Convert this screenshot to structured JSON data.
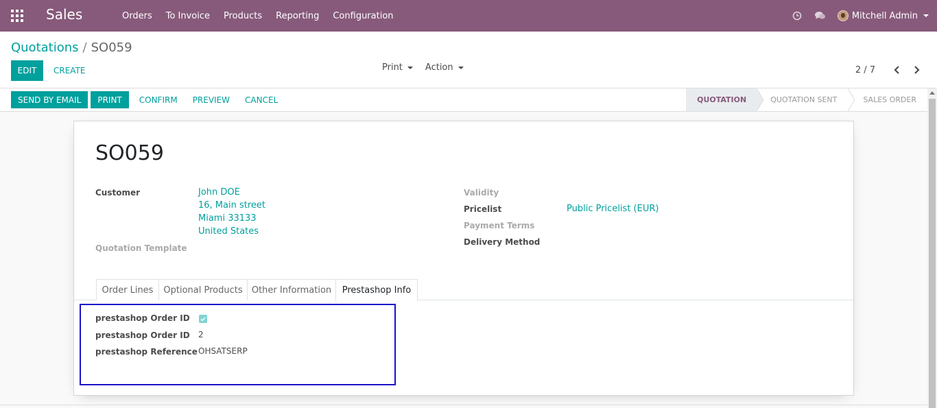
{
  "navbar": {
    "app_name": "Sales",
    "menu": [
      "Orders",
      "To Invoice",
      "Products",
      "Reporting",
      "Configuration"
    ],
    "user_name": "Mitchell Admin",
    "icons": [
      "apps-icon",
      "clock-icon",
      "chat-icon"
    ]
  },
  "control": {
    "breadcrumb_parent": "Quotations",
    "breadcrumb_current": "SO059",
    "edit_label": "EDIT",
    "create_label": "CREATE",
    "print_label": "Print",
    "action_label": "Action",
    "pager": "2 / 7"
  },
  "statusbar": {
    "buttons": [
      "SEND BY EMAIL",
      "PRINT",
      "CONFIRM",
      "PREVIEW",
      "CANCEL"
    ],
    "stages": [
      "QUOTATION",
      "QUOTATION SENT",
      "SALES ORDER"
    ],
    "active_stage": "QUOTATION"
  },
  "form": {
    "order_name": "SO059",
    "customer_label": "Customer",
    "customer_name": "John DOE",
    "customer_address": [
      "16, Main street",
      "Miami 33133",
      "United States"
    ],
    "quotation_template_label": "Quotation Template",
    "validity_label": "Validity",
    "pricelist_label": "Pricelist",
    "pricelist_value": "Public Pricelist (EUR)",
    "payment_terms_label": "Payment Terms",
    "delivery_method_label": "Delivery Method"
  },
  "tabs": [
    "Order Lines",
    "Optional Products",
    "Other Information",
    "Prestashop Info"
  ],
  "active_tab": "Prestashop Info",
  "prestashop": {
    "order_id_flag_label": "prestashop Order ID",
    "order_id_flag_checked": true,
    "order_id_label": "prestashop Order ID",
    "order_id_value": "2",
    "reference_label": "prestashop Reference",
    "reference_value": "OHSATSERP"
  },
  "colors": {
    "navbar": "#875a7b",
    "primary": "#00a09d",
    "highlight_box": "#1a11c8"
  }
}
